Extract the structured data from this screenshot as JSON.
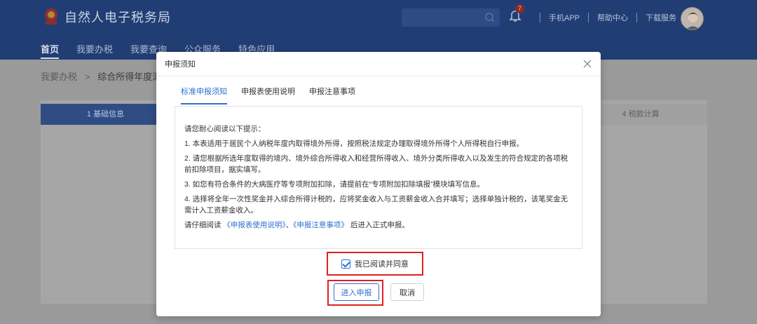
{
  "header": {
    "site_title": "自然人电子税务局",
    "notification_count": "7",
    "links": [
      "手机APP",
      "帮助中心",
      "下载服务"
    ]
  },
  "nav": {
    "items": [
      "首页",
      "我要办税",
      "我要查询",
      "公众服务",
      "特色应用"
    ]
  },
  "breadcrumb": {
    "root": "我要办税",
    "separator": ">",
    "current": "综合所得年度汇"
  },
  "steps": {
    "step1": "1 基础信息",
    "step4": "4 税款计算"
  },
  "modal": {
    "title": "申报须知",
    "tabs": [
      "标准申报须知",
      "申报表使用说明",
      "申报注意事项"
    ],
    "intro": "请您耐心阅读以下提示：",
    "items": [
      "1. 本表适用于居民个人纳税年度内取得境外所得，按照税法规定办理取得境外所得个人所得税自行申报。",
      "2. 请您根据所选年度取得的境内、境外综合所得收入和经营所得收入、境外分类所得收入以及发生的符合规定的各项税前扣除项目，据实填写。",
      "3. 如您有符合条件的大病医疗等专项附加扣除，请提前在“专项附加扣除填报”模块填写信息。",
      "4. 选择将全年一次性奖金并入综合所得计税的，应将奖金收入与工资薪金收入合并填写；选择单独计税的，该笔奖金无需计入工资薪金收入。"
    ],
    "footer_prefix": "请仔细阅读",
    "footer_link1": "《申报表使用说明》",
    "footer_sep": "、",
    "footer_link2": "《申报注意事项》",
    "footer_suffix": "后进入正式申报。",
    "agree_label": "我已阅读并同意",
    "submit_label": "进入申报",
    "cancel_label": "取消"
  },
  "colors": {
    "header_bg": "#213e74",
    "accent": "#2f6fd1",
    "highlight": "#e02020"
  }
}
